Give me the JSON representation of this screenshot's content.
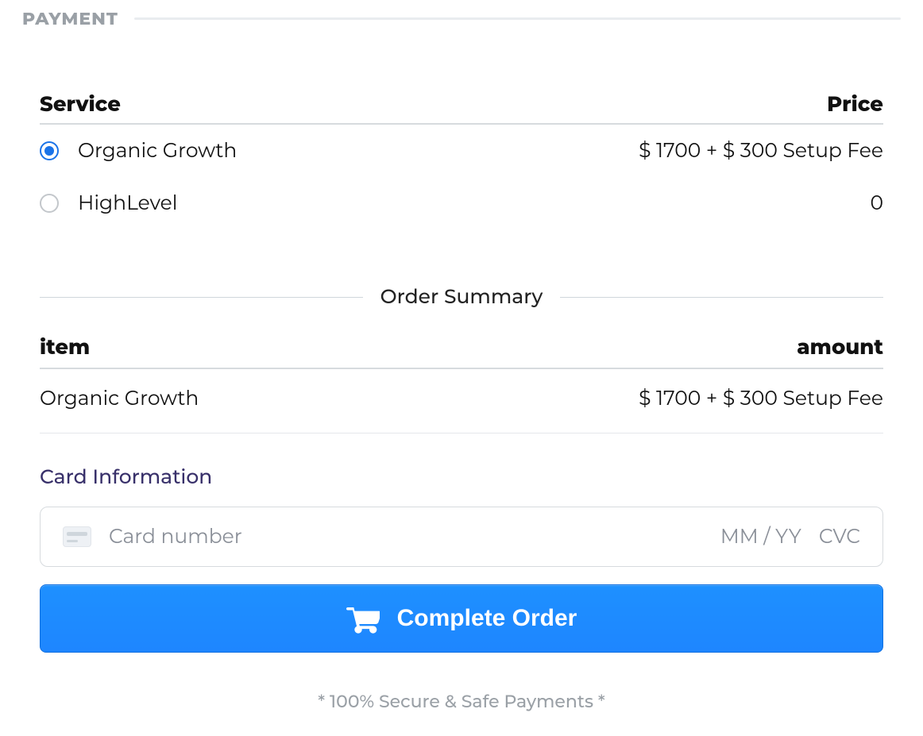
{
  "section_title": "PAYMENT",
  "service_table": {
    "col_service": "Service",
    "col_price": "Price",
    "options": [
      {
        "name": "Organic Growth",
        "price": "$ 1700 + $ 300 Setup Fee",
        "selected": true
      },
      {
        "name": "HighLevel",
        "price": "0",
        "selected": false
      }
    ]
  },
  "order_summary": {
    "title": "Order Summary",
    "col_item": "item",
    "col_amount": "amount",
    "rows": [
      {
        "item": "Organic Growth",
        "amount": "$ 1700 + $ 300 Setup Fee"
      }
    ]
  },
  "card": {
    "label": "Card Information",
    "placeholder": "Card number",
    "expiry_placeholder": "MM / YY",
    "cvc_placeholder": "CVC"
  },
  "submit_label": "Complete Order",
  "footnote": "* 100% Secure & Safe Payments *"
}
